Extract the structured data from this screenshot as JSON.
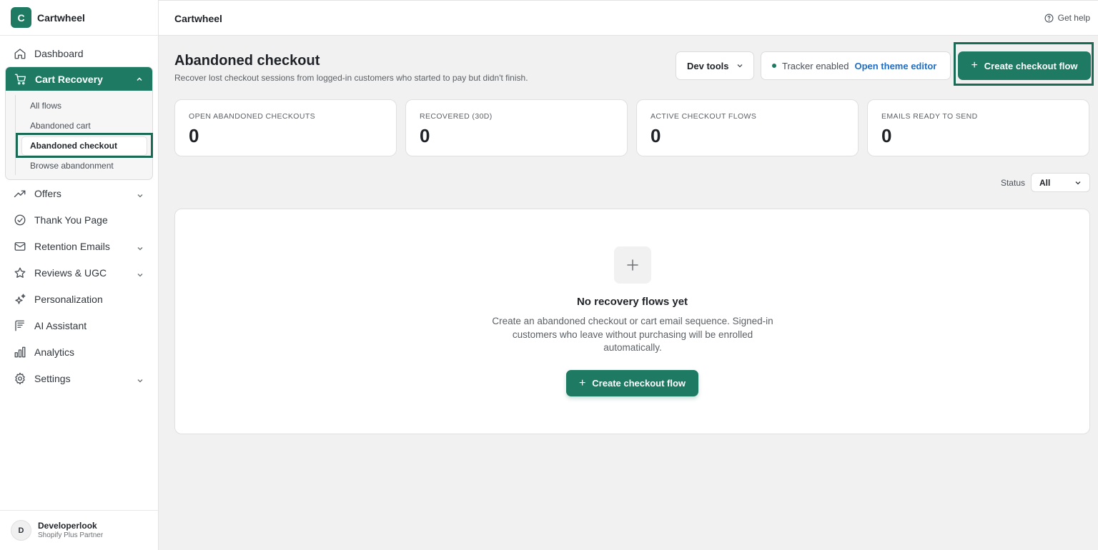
{
  "brand": {
    "initial": "C",
    "name": "Cartwheel"
  },
  "sidebar": {
    "items": [
      {
        "label": "Dashboard",
        "icon": "home-icon"
      },
      {
        "label": "Cart Recovery",
        "icon": "cart-icon"
      },
      {
        "label": "Offers",
        "icon": "trending-icon"
      },
      {
        "label": "Thank You Page",
        "icon": "check-circle-icon"
      },
      {
        "label": "Retention Emails",
        "icon": "mail-icon"
      },
      {
        "label": "Reviews & UGC",
        "icon": "star-icon"
      },
      {
        "label": "Personalization",
        "icon": "sparkle-icon"
      },
      {
        "label": "AI Assistant",
        "icon": "ai-icon"
      },
      {
        "label": "Analytics",
        "icon": "bar-chart-icon"
      },
      {
        "label": "Settings",
        "icon": "gear-icon"
      }
    ],
    "cart_sub": [
      "All flows",
      "Abandoned cart",
      "Abandoned checkout",
      "Browse abandonment"
    ]
  },
  "user": {
    "initial": "D",
    "name": "Developerlook",
    "role": "Shopify Plus Partner"
  },
  "topbar": {
    "title": "Cartwheel",
    "help": "Get help"
  },
  "page": {
    "title": "Abandoned checkout",
    "subtitle": "Recover lost checkout sessions from logged-in customers who started to pay but didn't finish.",
    "dev_tools": "Dev tools",
    "tracker_status": "Tracker enabled",
    "theme_editor": "Open theme editor",
    "create_flow": "Create checkout flow"
  },
  "stats": [
    {
      "label": "OPEN ABANDONED CHECKOUTS",
      "value": "0"
    },
    {
      "label": "RECOVERED (30D)",
      "value": "0"
    },
    {
      "label": "ACTIVE CHECKOUT FLOWS",
      "value": "0"
    },
    {
      "label": "EMAILS READY TO SEND",
      "value": "0"
    }
  ],
  "filter": {
    "label": "Status",
    "value": "All"
  },
  "empty": {
    "title": "No recovery flows yet",
    "description": "Create an abandoned checkout or cart email sequence. Signed-in customers who leave without purchasing will be enrolled automatically.",
    "cta": "Create checkout flow"
  },
  "colors": {
    "accent": "#1f7a63",
    "link": "#1f6fc5"
  }
}
